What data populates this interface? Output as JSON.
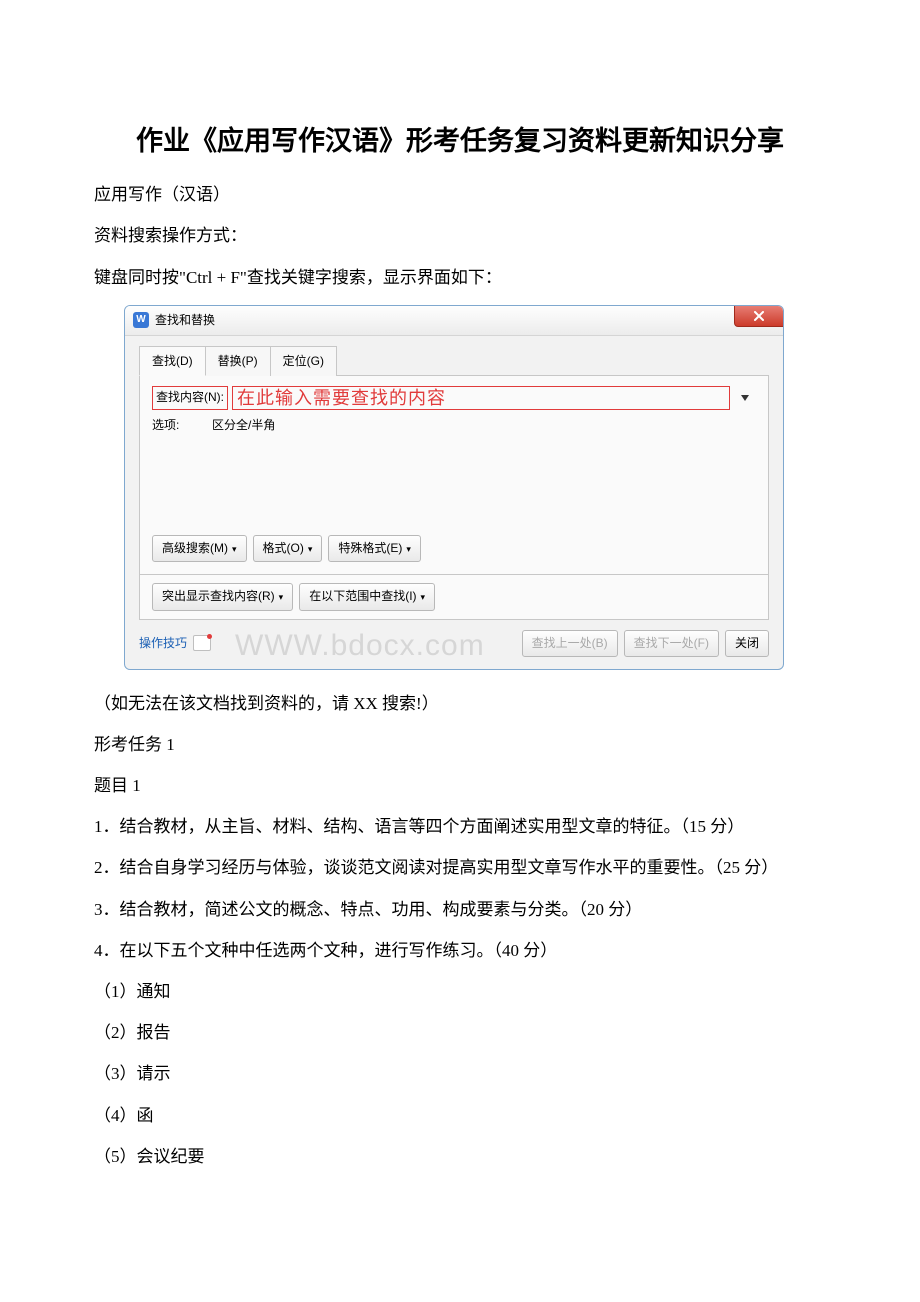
{
  "title": "作业《应用写作汉语》形考任务复习资料更新知识分享",
  "intro": {
    "p1": "应用写作（汉语）",
    "p2": "资料搜索操作方式：",
    "p3": "键盘同时按\"Ctrl + F\"查找关键字搜索，显示界面如下："
  },
  "dialog": {
    "title": "查找和替换",
    "tabs": {
      "find": "查找(D)",
      "replace": "替换(P)",
      "goto": "定位(G)"
    },
    "search_label": "查找内容(N):",
    "placeholder": "在此输入需要查找的内容",
    "options_label": "选项:",
    "options_value": "区分全/半角",
    "adv_search": "高级搜索(M)",
    "format": "格式(O)",
    "special": "特殊格式(E)",
    "highlight": "突出显示查找内容(R)",
    "find_in": "在以下范围中查找(I)",
    "tips": "操作技巧",
    "find_prev": "查找上一处(B)",
    "find_next": "查找下一处(F)",
    "close": "关闭",
    "watermark": "WWW.bdocx.com"
  },
  "body": {
    "note": "（如无法在该文档找到资料的，请 XX 搜索!）",
    "task": "形考任务 1",
    "q": "题目 1",
    "q1": "1．结合教材，从主旨、材料、结构、语言等四个方面阐述实用型文章的特征。（15 分）",
    "q2": "2．结合自身学习经历与体验，谈谈范文阅读对提高实用型文章写作水平的重要性。（25 分）",
    "q3": "3．结合教材，简述公文的概念、特点、功用、构成要素与分类。（20 分）",
    "q4": "4．在以下五个文种中任选两个文种，进行写作练习。（40 分）",
    "i1": "（1）通知",
    "i2": "（2）报告",
    "i3": "（3）请示",
    "i4": "（4）函",
    "i5": "（5）会议纪要"
  }
}
